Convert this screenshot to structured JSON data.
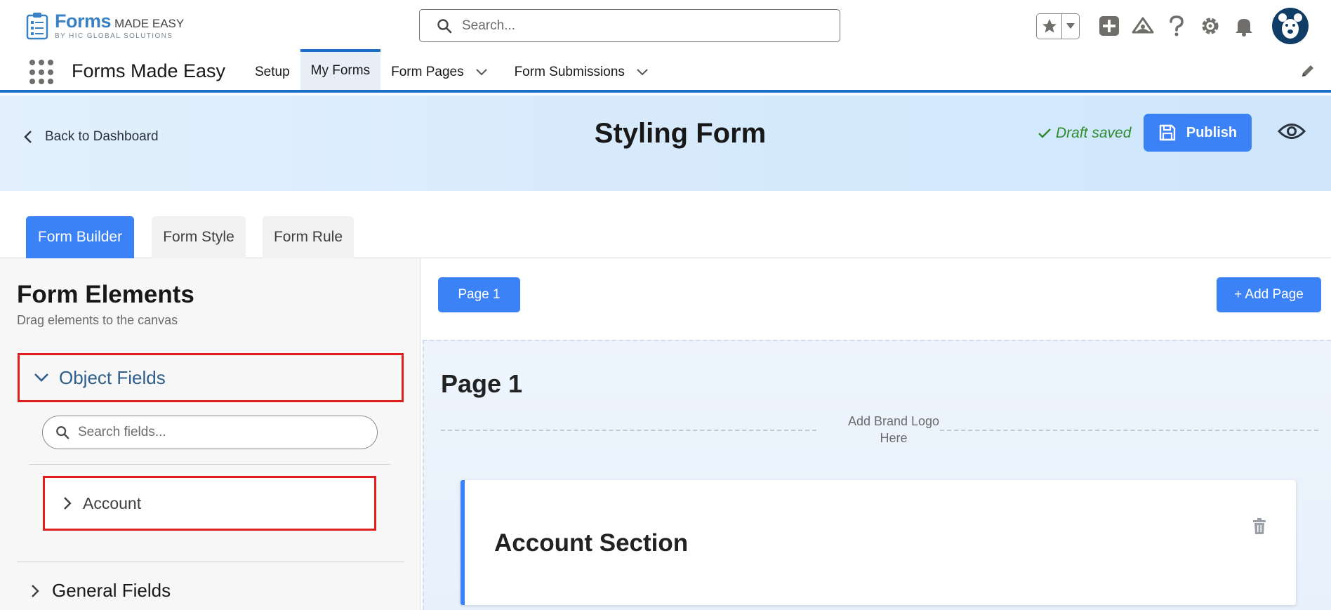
{
  "header": {
    "logo": {
      "brand": "Forms",
      "suffix": "MADE EASY",
      "subtitle": "BY HIC GLOBAL SOLUTIONS"
    },
    "search": {
      "placeholder": "Search..."
    },
    "icons": [
      "favorites-star-icon",
      "favorites-dropdown-icon",
      "global-add-icon",
      "trailhead-icon",
      "help-icon",
      "setup-gear-icon",
      "notifications-bell-icon",
      "user-avatar"
    ]
  },
  "app_nav": {
    "app_name": "Forms Made Easy",
    "items": [
      {
        "label": "Setup",
        "active": false,
        "dropdown": false
      },
      {
        "label": "My Forms",
        "active": true,
        "dropdown": false
      },
      {
        "label": "Form Pages",
        "active": false,
        "dropdown": true
      },
      {
        "label": "Form Submissions",
        "active": false,
        "dropdown": true
      }
    ]
  },
  "hero": {
    "back_label": "Back to Dashboard",
    "title": "Styling Form",
    "draft_status": "Draft saved",
    "publish_label": "Publish"
  },
  "tabs": [
    {
      "label": "Form Builder",
      "active": true
    },
    {
      "label": "Form Style",
      "active": false
    },
    {
      "label": "Form Rule",
      "active": false
    }
  ],
  "sidebar": {
    "title": "Form Elements",
    "subtitle": "Drag elements to the canvas",
    "object_fields_label": "Object Fields",
    "search_placeholder": "Search fields...",
    "account_label": "Account",
    "general_fields_label": "General Fields"
  },
  "canvas": {
    "page_button": "Page 1",
    "add_page_button": "+ Add Page",
    "page_heading": "Page 1",
    "brand_logo_placeholder": "Add Brand Logo Here",
    "section_title": "Account Section"
  },
  "colors": {
    "primary": "#3b82f6",
    "nav_accent": "#1a6fc9",
    "highlight_border": "#e01e1e",
    "draft_green": "#2e8b2e"
  }
}
